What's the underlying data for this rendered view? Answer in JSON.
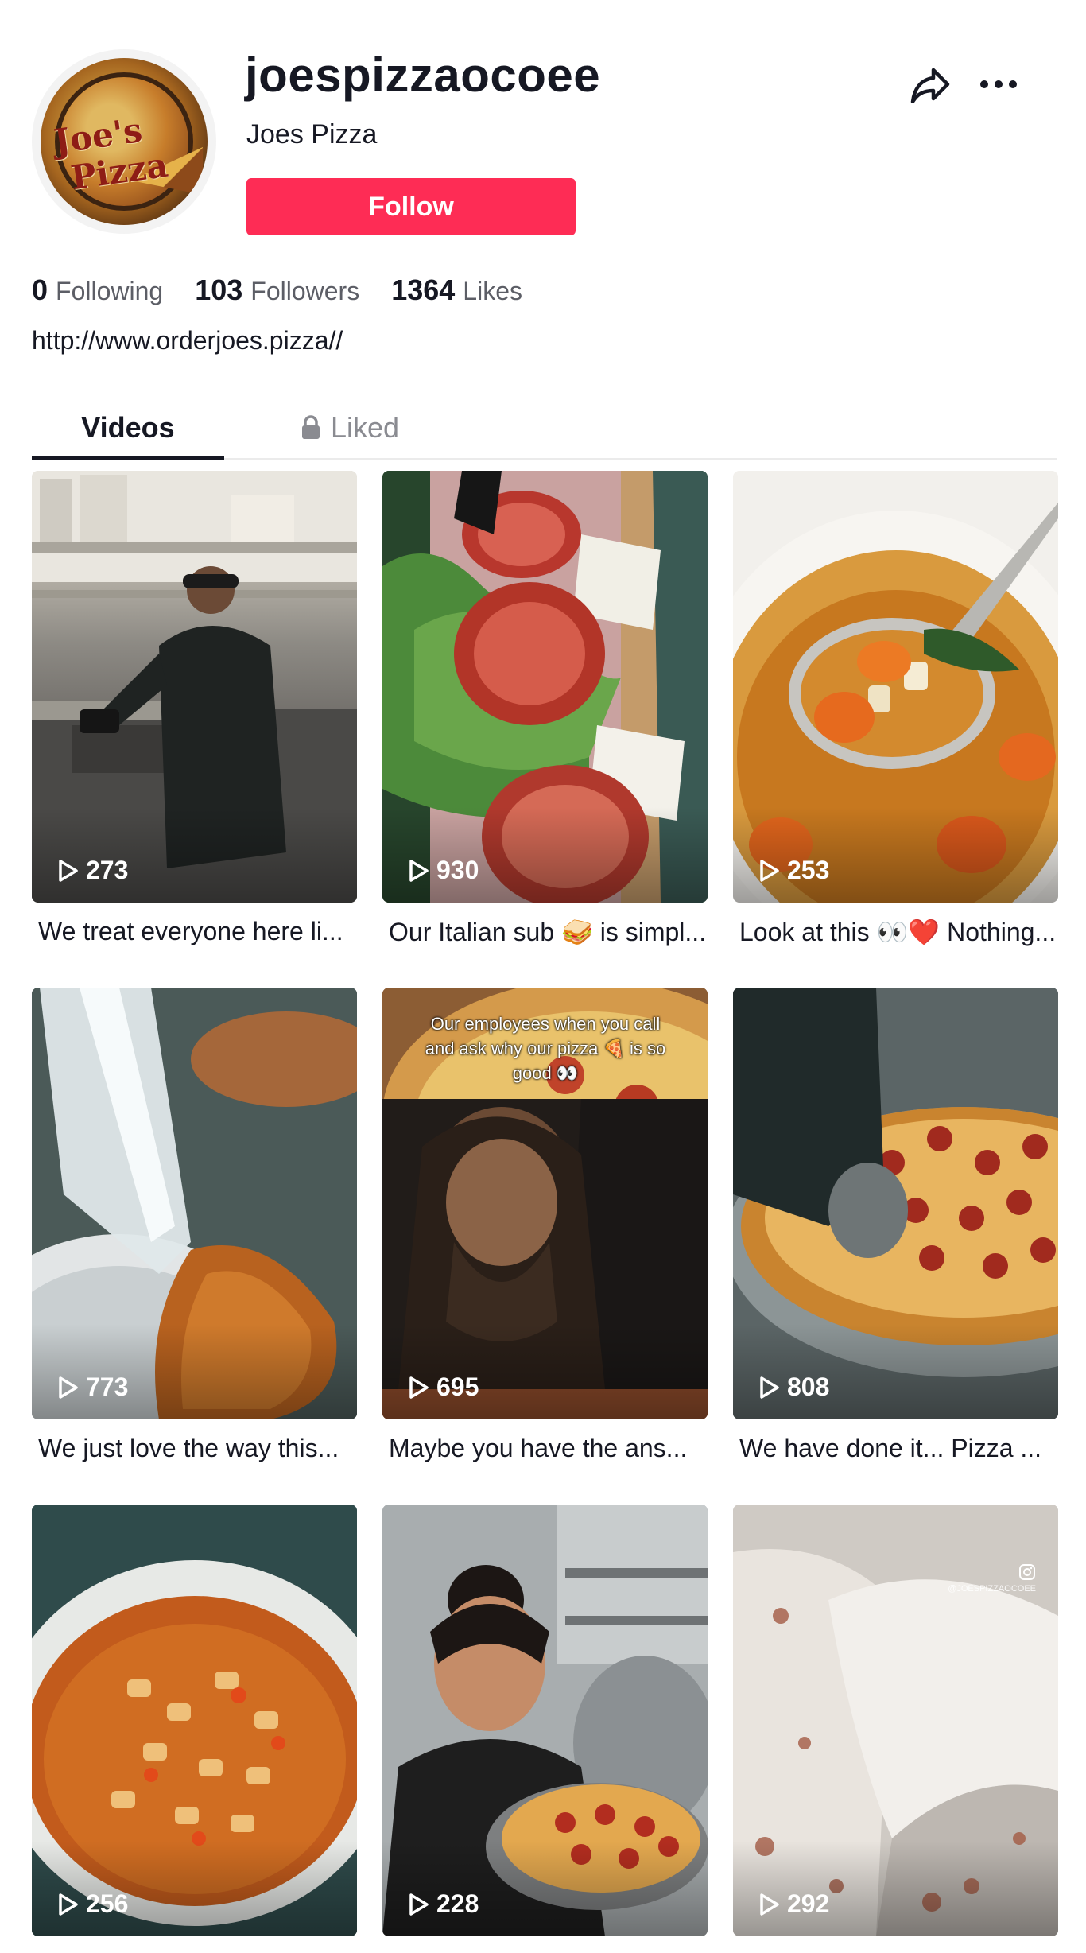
{
  "profile": {
    "username": "joespizzaocoee",
    "nickname": "Joes Pizza",
    "avatar_logo_text": "Joe's Pizza",
    "follow_label": "Follow",
    "link": "http://www.orderjoes.pizza//"
  },
  "stats": [
    {
      "num": "0",
      "label": "Following"
    },
    {
      "num": "103",
      "label": "Followers"
    },
    {
      "num": "1364",
      "label": "Likes"
    }
  ],
  "tabs": {
    "videos": "Videos",
    "liked": "Liked"
  },
  "videos": [
    {
      "views": "273",
      "caption": "We treat everyone here li...",
      "thumb": "kitchen-chef"
    },
    {
      "views": "930",
      "caption": "Our Italian sub 🥪 is simpl...",
      "thumb": "italian-sub"
    },
    {
      "views": "253",
      "caption": "Look at this 👀❤️ Nothing...",
      "thumb": "soup-spoon"
    },
    {
      "views": "773",
      "caption": "We just love the way this...",
      "thumb": "cheese-pull"
    },
    {
      "views": "695",
      "caption": "Maybe you have the ans...",
      "thumb": "meme-pizza",
      "overlay": "Our employees when you call and ask why our pizza 🍕 is so good 👀"
    },
    {
      "views": "808",
      "caption": "We have done it... Pizza ...",
      "thumb": "pepperoni-cut"
    },
    {
      "views": "256",
      "caption": "",
      "thumb": "pasta-soup"
    },
    {
      "views": "228",
      "caption": "",
      "thumb": "woman-pizza"
    },
    {
      "views": "292",
      "caption": "",
      "thumb": "cheese-close",
      "watermark": "@JOESPIZZAOCOEE"
    }
  ],
  "colors": {
    "accent": "#fe2c55",
    "text": "#161823",
    "muted": "#5c5e66"
  }
}
